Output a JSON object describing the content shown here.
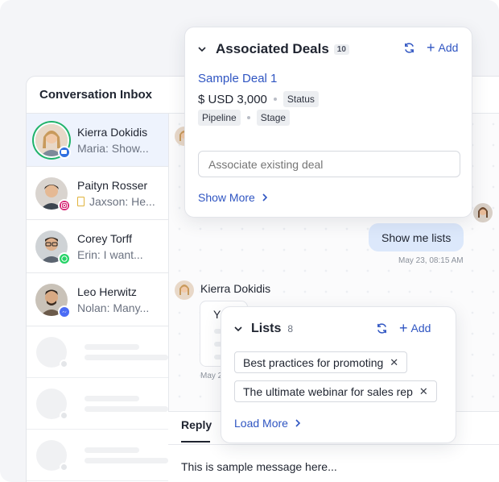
{
  "inbox": {
    "title": "Conversation Inbox",
    "contacts": [
      {
        "name": "Kierra Dokidis",
        "preview": "Maria: Show...",
        "channel": "chat-icon",
        "channel_color": "#2f6fe0",
        "active": true
      },
      {
        "name": "Paityn Rosser",
        "preview": "Jaxson: He...",
        "channel": "instagram-icon",
        "channel_color": "#d62976"
      },
      {
        "name": "Corey Torff",
        "preview": "Erin: I want...",
        "channel": "whatsapp-icon",
        "channel_color": "#25d366"
      },
      {
        "name": "Leo Herwitz",
        "preview": "Nolan: Many...",
        "channel": "messenger-icon",
        "channel_color": "#4b6cf5"
      }
    ]
  },
  "chat": {
    "outgoing_message": "Show me lists",
    "outgoing_time": "May 23, 08:15 AM",
    "incoming_sender": "Kierra Dokidis",
    "incoming_snippet": "Y",
    "incoming_time": "May 2",
    "reply_tab": "Reply",
    "reply_text": "This is sample message here..."
  },
  "deals": {
    "title": "Associated Deals",
    "count": "10",
    "add_label": "Add",
    "deal_name": "Sample Deal 1",
    "amount": "$ USD 3,000",
    "status_tag": "Status",
    "pipeline_tag": "Pipeline",
    "stage_tag": "Stage",
    "input_placeholder": "Associate existing deal",
    "show_more": "Show More"
  },
  "lists": {
    "title": "Lists",
    "count": "8",
    "add_label": "Add",
    "items": [
      "Best practices for promoting",
      "The ultimate webinar for sales rep"
    ],
    "load_more": "Load More"
  },
  "colors": {
    "accent": "#2f55c2",
    "bubble": "#dce8fb",
    "active_row": "#eef3fd",
    "online_ring": "#20b36b"
  }
}
